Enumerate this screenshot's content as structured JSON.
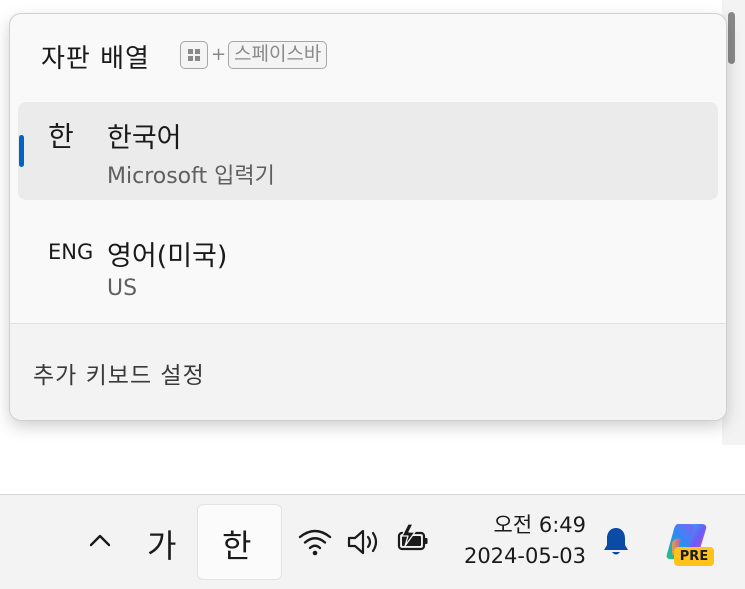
{
  "flyout": {
    "title": "자판 배열",
    "shortcut": {
      "plus": "+",
      "space_key": "스페이스바"
    },
    "languages": [
      {
        "short": "한",
        "name": "한국어",
        "keyboard": "Microsoft 입력기",
        "selected": true
      },
      {
        "short": "ENG",
        "name": "영어(미국)",
        "keyboard": "US",
        "selected": false
      }
    ],
    "settings_link": "추가 키보드 설정"
  },
  "taskbar": {
    "input_mode": "가",
    "ime_indicator": "한",
    "time": "오전 6:49",
    "date": "2024-05-03",
    "copilot_badge": "PRE",
    "icons": [
      "chevron-up-icon",
      "wifi-icon",
      "volume-icon",
      "battery-charging-icon",
      "bell-icon",
      "copilot-icon"
    ]
  },
  "colors": {
    "accent": "#0063c6",
    "bell": "#0a4ba6",
    "badge": "#ffc21a"
  }
}
